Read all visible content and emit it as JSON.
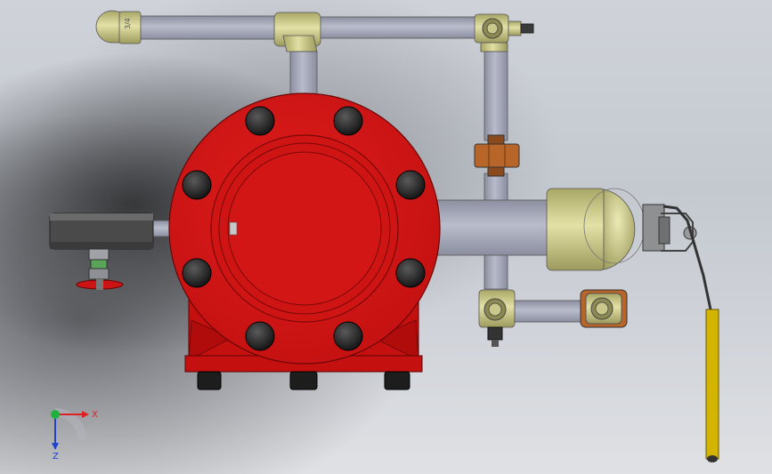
{
  "viewport": {
    "background": "#d5d8dd"
  },
  "model": {
    "fitting_marking": "3/4",
    "colors": {
      "valve_body": "#d41414",
      "valve_dark": "#8c0808",
      "pipe": "#a7abbb",
      "pipe_dark": "#7c8090",
      "brass": "#c9c78a",
      "brass_dark": "#8f8c54",
      "nut_orange": "#b8652a",
      "bolt": "#1c1c1c",
      "handle": "#d3b400"
    }
  },
  "triad": {
    "x_label": "X",
    "z_label": "Z",
    "x_color": "#e02020",
    "z_color": "#2040d0",
    "origin_color": "#20b040"
  }
}
